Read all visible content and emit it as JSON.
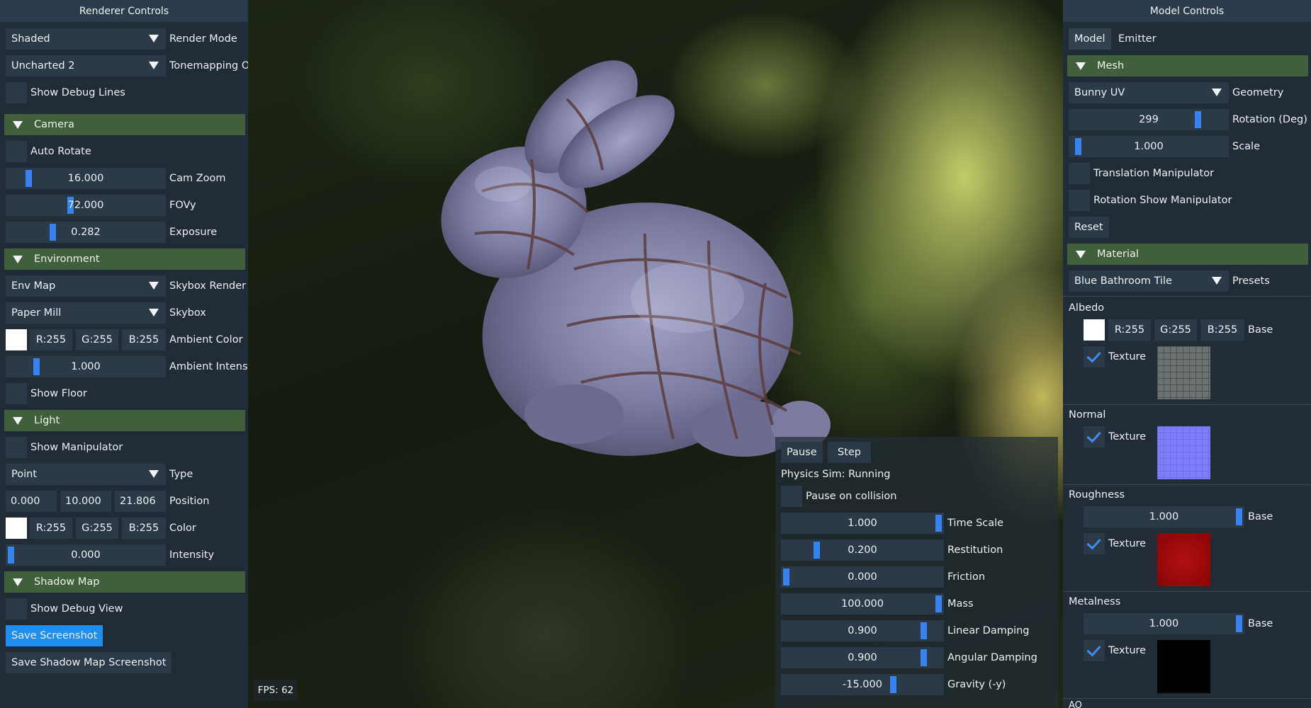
{
  "left": {
    "title": "Renderer Controls",
    "render_mode": {
      "value": "Shaded",
      "label": "Render Mode"
    },
    "tonemapping": {
      "value": "Uncharted 2",
      "label": "Tonemapping Ope"
    },
    "show_debug_lines": "Show Debug Lines",
    "camera": {
      "header": "Camera",
      "auto_rotate": "Auto Rotate",
      "cam_zoom": {
        "value": "16.000",
        "label": "Cam Zoom",
        "fraction": 0.12
      },
      "fovy": {
        "value": "72.000",
        "label": "FOVy",
        "fraction": 0.4
      },
      "exposure": {
        "value": "0.282",
        "label": "Exposure",
        "fraction": 0.28
      }
    },
    "environment": {
      "header": "Environment",
      "skybox_render_mode": {
        "value": "Env Map",
        "label": "Skybox Render Mo"
      },
      "skybox": {
        "value": "Paper Mill",
        "label": "Skybox"
      },
      "ambient_color": {
        "r": "R:255",
        "g": "G:255",
        "b": "B:255",
        "label": "Ambient Color"
      },
      "ambient_intensity": {
        "value": "1.000",
        "label": "Ambient Intensity",
        "fraction": 0.17
      },
      "show_floor": "Show Floor"
    },
    "light": {
      "header": "Light",
      "show_manipulator": "Show Manipulator",
      "type": {
        "value": "Point",
        "label": "Type"
      },
      "position": {
        "x": "0.000",
        "y": "10.000",
        "z": "21.806",
        "label": "Position"
      },
      "color": {
        "r": "R:255",
        "g": "G:255",
        "b": "B:255",
        "label": "Color"
      },
      "intensity": {
        "value": "0.000",
        "label": "Intensity",
        "fraction": 0.0
      }
    },
    "shadow_map": {
      "header": "Shadow Map",
      "show_debug_view": "Show Debug View"
    },
    "save_screenshot": "Save Screenshot",
    "save_shadow_map_screenshot": "Save Shadow Map Screenshot"
  },
  "right": {
    "title": "Model Controls",
    "tabs": [
      {
        "label": "Model"
      },
      {
        "label": "Emitter"
      }
    ],
    "mesh": {
      "header": "Mesh",
      "geometry": {
        "value": "Bunny UV",
        "label": "Geometry"
      },
      "rotation": {
        "value": "299",
        "label": "Rotation (Deg)",
        "fraction": 0.83
      },
      "scale": {
        "value": "1.000",
        "label": "Scale",
        "fraction": 0.03
      },
      "translation_manipulator": "Translation Manipulator",
      "rotation_show_manipulator": "Rotation Show Manipulator",
      "reset": "Reset"
    },
    "material": {
      "header": "Material",
      "presets": {
        "value": "Blue Bathroom Tile",
        "label": "Presets"
      },
      "albedo": {
        "title": "Albedo",
        "r": "R:255",
        "g": "G:255",
        "b": "B:255",
        "base_label": "Base",
        "texture_label": "Texture"
      },
      "normal": {
        "title": "Normal",
        "texture_label": "Texture"
      },
      "roughness": {
        "title": "Roughness",
        "value": "1.000",
        "fraction": 1.0,
        "base_label": "Base",
        "texture_label": "Texture"
      },
      "metalness": {
        "title": "Metalness",
        "value": "1.000",
        "fraction": 1.0,
        "base_label": "Base",
        "texture_label": "Texture"
      },
      "ao_title": "AO"
    }
  },
  "physics": {
    "pause": "Pause",
    "step": "Step",
    "status": "Physics Sim: Running",
    "pause_on_collision": "Pause on collision",
    "sliders": [
      {
        "value": "1.000",
        "label": "Time Scale",
        "fraction": 1.0
      },
      {
        "value": "0.200",
        "label": "Restitution",
        "fraction": 0.2
      },
      {
        "value": "0.000",
        "label": "Friction",
        "fraction": 0.0
      },
      {
        "value": "100.000",
        "label": "Mass",
        "fraction": 1.0
      },
      {
        "value": "0.900",
        "label": "Linear Damping",
        "fraction": 0.9
      },
      {
        "value": "0.900",
        "label": "Angular Damping",
        "fraction": 0.9
      },
      {
        "value": "-15.000",
        "label": "Gravity (-y)",
        "fraction": 0.7
      }
    ]
  },
  "fps": "FPS: 62",
  "colors": {
    "accent": "#3583ee",
    "header_green": "#415e3d",
    "panel_bg": "#212c36",
    "button_blue": "#1e8ef0"
  }
}
